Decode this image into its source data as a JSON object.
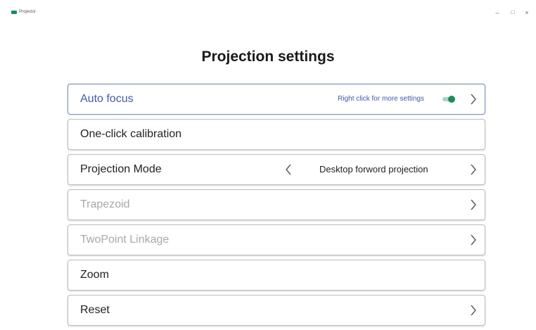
{
  "window": {
    "app_name": "Projector",
    "minimize_glyph": "–",
    "maximize_glyph": "□",
    "close_glyph": "×"
  },
  "page": {
    "title": "Projection settings"
  },
  "settings": {
    "auto_focus": {
      "label": "Auto focus",
      "hint": "Right click for more settings",
      "enabled": true
    },
    "calibration": {
      "label": "One-click calibration"
    },
    "projection_mode": {
      "label": "Projection Mode",
      "value": "Desktop forword projection"
    },
    "trapezoid": {
      "label": "Trapezoid"
    },
    "twopoint": {
      "label": "TwoPoint Linkage"
    },
    "zoom": {
      "label": "Zoom"
    },
    "reset": {
      "label": "Reset"
    }
  },
  "icons": {
    "app": "projector-app-icon",
    "chevron_right": "chevron-right-icon",
    "chevron_left": "chevron-left-icon"
  },
  "colors": {
    "accent_text": "#3f5aa8",
    "toggle_on": "#1e8a5c",
    "disabled_text": "#a8a8a8"
  }
}
